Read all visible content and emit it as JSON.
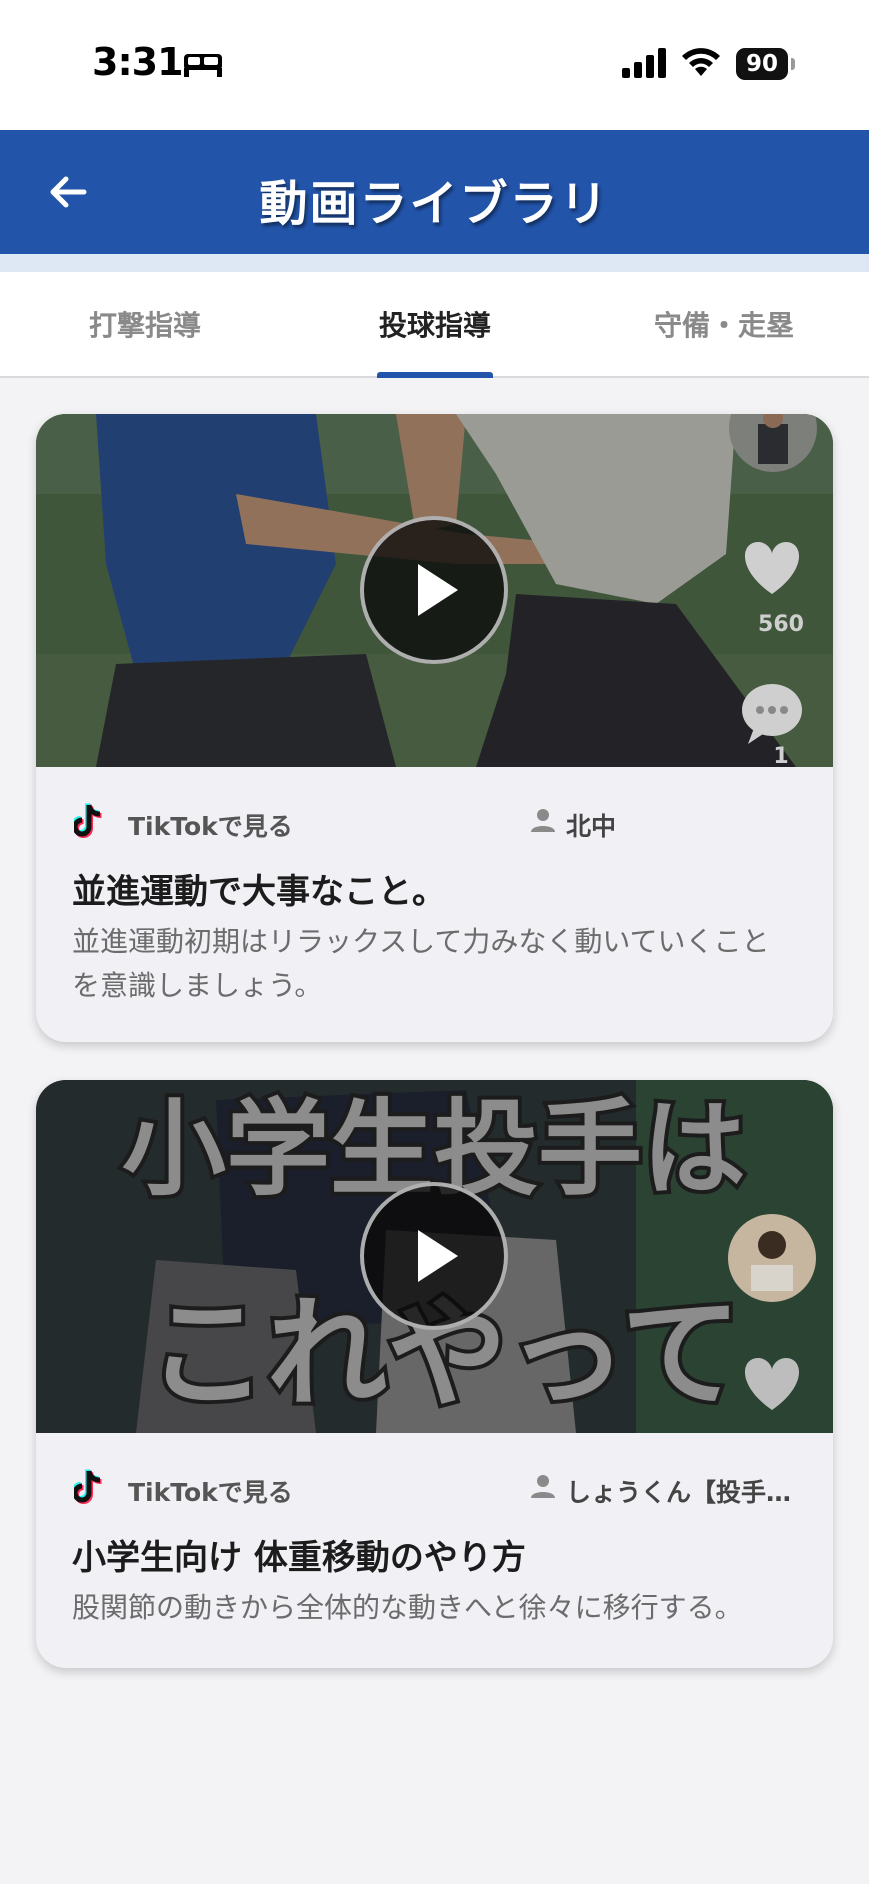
{
  "status_bar": {
    "time": "3:31",
    "battery": "90",
    "icons": [
      "sleep-bed-icon",
      "cellular-signal-icon",
      "wifi-icon",
      "battery-icon"
    ]
  },
  "header": {
    "title": "動画ライブラリ",
    "back_icon": "arrow-left-icon"
  },
  "tabs": [
    {
      "label": "打撃指導",
      "active": false
    },
    {
      "label": "投球指導",
      "active": true
    },
    {
      "label": "守備・走塁",
      "active": false
    }
  ],
  "videos": [
    {
      "link_label": "TikTokで見る",
      "author": "北中",
      "title": "並進運動で大事なこと。",
      "description": "並進運動初期はリラックスして力みなく動いていくことを意識しましょう。",
      "likes": "560",
      "comments": "1"
    },
    {
      "link_label": "TikTokで見る",
      "author": "しょうくん【投手…",
      "title": "小学生向け 体重移動のやり方",
      "description": "股関節の動きから全体的な動きへと徐々に移行する。",
      "overlay_text_line1": "小学生投手は",
      "overlay_text_line2": "これやって"
    }
  ],
  "colors": {
    "header_blue": "#2254aa",
    "tab_active_indicator": "#2254aa",
    "card_bg": "#f0f0f5",
    "page_bg": "#f3f3f5"
  }
}
